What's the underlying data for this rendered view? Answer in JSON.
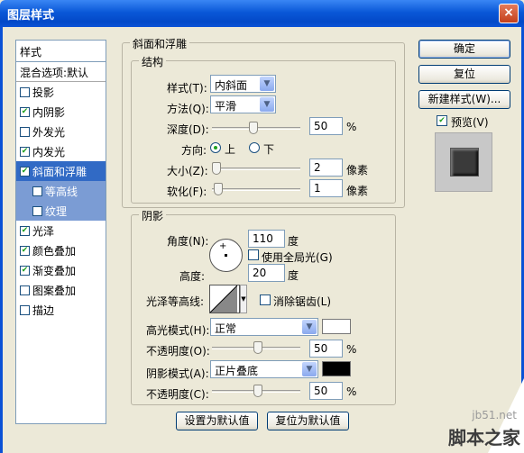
{
  "window": {
    "title": "图层样式",
    "close_symbol": "×"
  },
  "left_panel": {
    "header": "样式",
    "blend_options": "混合选项:默认",
    "items": [
      {
        "label": "投影",
        "checked": false
      },
      {
        "label": "内阴影",
        "checked": true
      },
      {
        "label": "外发光",
        "checked": false
      },
      {
        "label": "内发光",
        "checked": true
      },
      {
        "label": "斜面和浮雕",
        "checked": true,
        "selected": true
      },
      {
        "label": "等高线",
        "checked": false,
        "sub": true
      },
      {
        "label": "纹理",
        "checked": false,
        "sub": true
      },
      {
        "label": "光泽",
        "checked": true
      },
      {
        "label": "颜色叠加",
        "checked": true
      },
      {
        "label": "渐变叠加",
        "checked": true
      },
      {
        "label": "图案叠加",
        "checked": false
      },
      {
        "label": "描边",
        "checked": false
      }
    ]
  },
  "bevel": {
    "section_title": "斜面和浮雕",
    "structure_title": "结构",
    "style_label": "样式(T):",
    "style_value": "内斜面",
    "technique_label": "方法(Q):",
    "technique_value": "平滑",
    "depth_label": "深度(D):",
    "depth_value": "50",
    "depth_unit": "%",
    "depth_level": 0.5,
    "direction_label": "方向:",
    "direction_up": "上",
    "direction_down": "下",
    "size_label": "大小(Z):",
    "size_value": "2",
    "size_unit": "像素",
    "soften_label": "软化(F):",
    "soften_value": "1",
    "soften_unit": "像素"
  },
  "shading": {
    "title": "阴影",
    "angle_label": "角度(N):",
    "angle_value": "110",
    "angle_unit": "度",
    "global_light_label": "使用全局光(G)",
    "global_light_checked": false,
    "altitude_label": "高度:",
    "altitude_value": "20",
    "altitude_unit": "度",
    "gloss_contour_label": "光泽等高线:",
    "anti_alias_label": "消除锯齿(L)",
    "anti_alias_checked": false,
    "highlight_mode_label": "高光模式(H):",
    "highlight_mode_value": "正常",
    "highlight_color": "#ffffff",
    "highlight_opacity_label": "不透明度(O):",
    "highlight_opacity_value": "50",
    "highlight_opacity_unit": "%",
    "shadow_mode_label": "阴影模式(A):",
    "shadow_mode_value": "正片叠底",
    "shadow_color": "#000000",
    "shadow_opacity_label": "不透明度(C):",
    "shadow_opacity_value": "50",
    "shadow_opacity_unit": "%"
  },
  "footer": {
    "make_default": "设置为默认值",
    "reset_default": "复位为默认值"
  },
  "right": {
    "ok": "确定",
    "reset": "复位",
    "new_style": "新建样式(W)...",
    "preview_label": "预览(V)",
    "preview_checked": true
  },
  "watermark": {
    "site": "jb51.net",
    "brand": "脚本之家"
  },
  "colors": {
    "accent": "#316ac5",
    "title_bar": "#0b52d6"
  }
}
